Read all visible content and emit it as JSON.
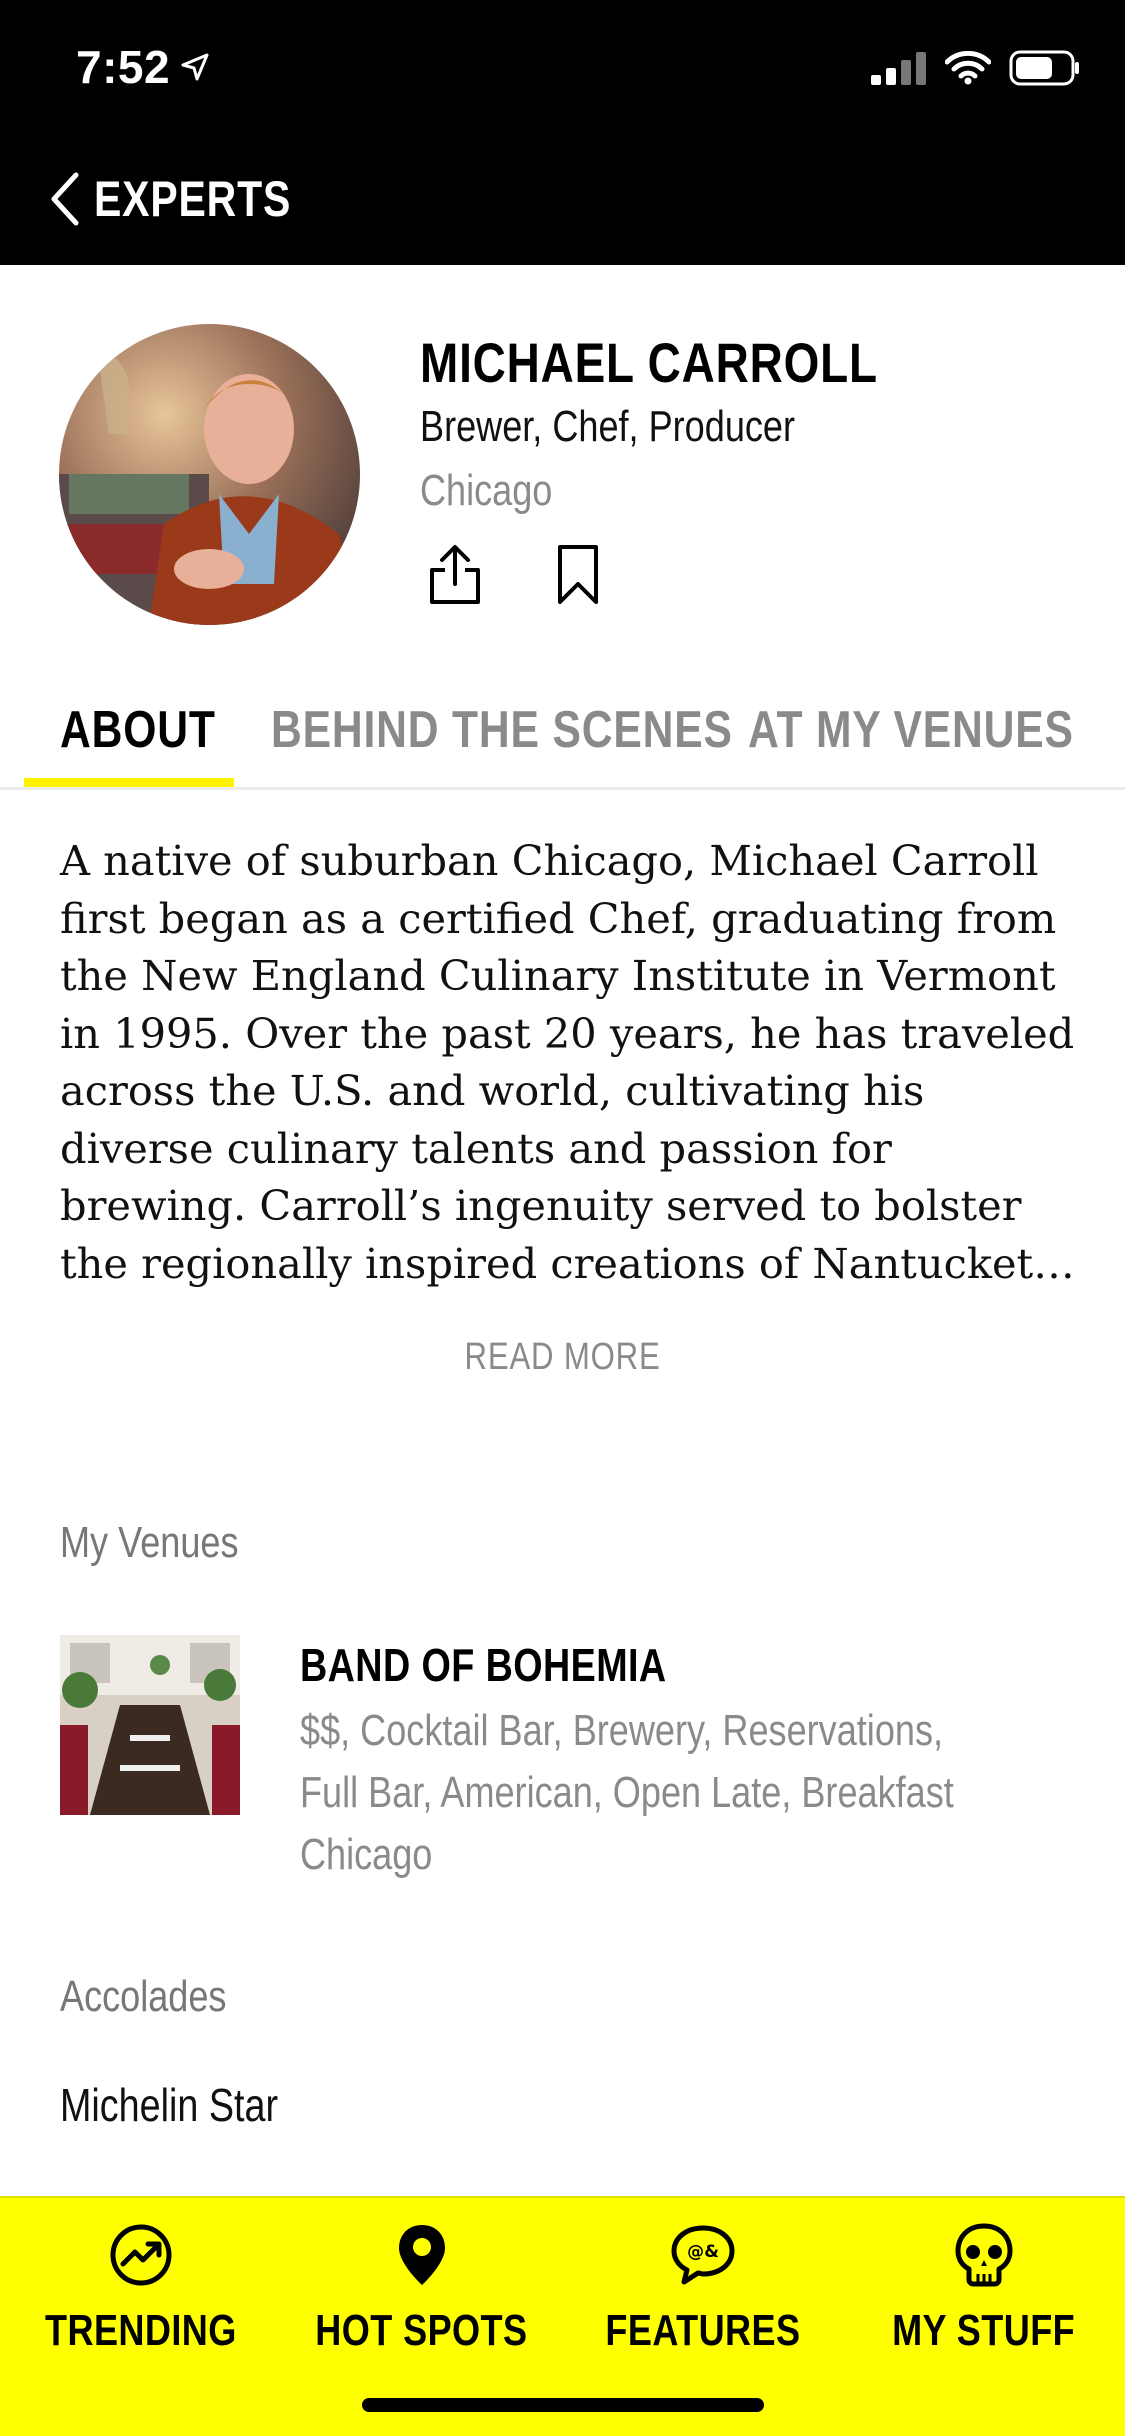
{
  "status_bar": {
    "time": "7:52"
  },
  "nav": {
    "back_label": "EXPERTS"
  },
  "profile": {
    "name": "MICHAEL CARROLL",
    "roles": "Brewer, Chef, Producer",
    "city": "Chicago"
  },
  "tabs": [
    {
      "label": "ABOUT",
      "active": true
    },
    {
      "label": "BEHIND THE SCENES",
      "active": false
    },
    {
      "label": "AT MY VENUES",
      "active": false
    }
  ],
  "bio": {
    "lines": [
      "A native of suburban Chicago, Michael Carroll",
      "first began as a certified Chef, graduating from",
      "the New England Culinary Institute in Vermont",
      "in 1995. Over the past 20 years, he has traveled",
      "across the U.S. and world, cultivating his",
      "diverse culinary talents and passion for",
      "brewing.   Carroll’s ingenuity served to bolster",
      "the regionally inspired creations of Nantucket…"
    ],
    "read_more": "READ MORE"
  },
  "venues": {
    "label": "My Venues",
    "items": [
      {
        "name": "BAND OF BOHEMIA",
        "tag_lines": [
          "$$, Cocktail Bar, Brewery, Reservations,",
          "Full Bar, American, Open Late, Breakfast",
          "Chicago"
        ]
      }
    ]
  },
  "accolades": {
    "label": "Accolades",
    "items": [
      "Michelin Star"
    ]
  },
  "bottom_nav": [
    {
      "label": "TRENDING",
      "icon": "trending-icon",
      "active": false
    },
    {
      "label": "HOT SPOTS",
      "icon": "location-pin-icon",
      "active": true
    },
    {
      "label": "FEATURES",
      "icon": "chat-bubble-icon",
      "active": false
    },
    {
      "label": "MY STUFF",
      "icon": "skull-icon",
      "active": false
    }
  ],
  "colors": {
    "accent": "#ffff00",
    "header_bg": "#000000",
    "muted_text": "#8a8a8a"
  }
}
